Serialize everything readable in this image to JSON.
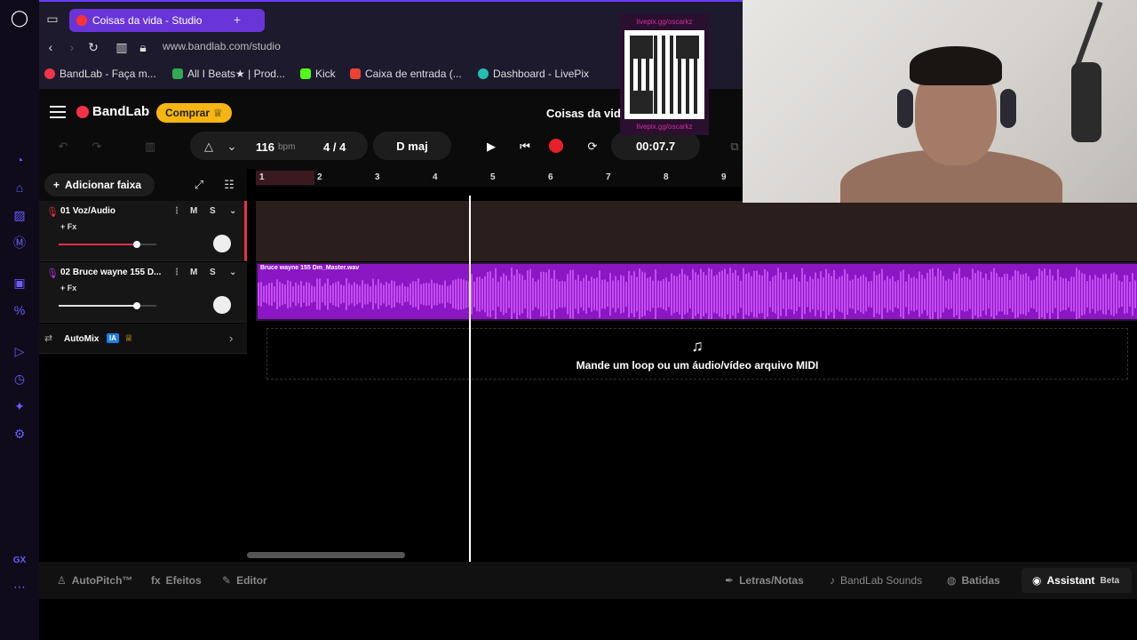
{
  "browser": {
    "tab_title": "Coisas da vida - Studio",
    "new_tab": "+",
    "url": "www.bandlab.com/studio",
    "bookmarks": [
      {
        "label": "BandLab - Faça m...",
        "color": "#f2334a"
      },
      {
        "label": "All I Beats★ | Prod...",
        "color": "#34a853"
      },
      {
        "label": "Kick",
        "color": "#53fc18"
      },
      {
        "label": "Caixa de entrada (...",
        "color": "#ea4335"
      },
      {
        "label": "Dashboard - LivePix",
        "color": "#20c0b0"
      }
    ]
  },
  "header": {
    "brand": "BandLab",
    "buy_label": "Comprar",
    "project_title": "Coisas da vid"
  },
  "transport": {
    "bpm_value": "116",
    "bpm_unit": "bpm",
    "time_sig": "4 / 4",
    "key": "D maj",
    "time": "00:07.7"
  },
  "tracks_panel": {
    "add_track_label": "Adicionar faixa",
    "tracks": [
      {
        "name": "01  Voz/Áudio",
        "fx": "+ Fx",
        "mute": "M",
        "solo": "S",
        "volume": 0.8,
        "color": "#e8304a"
      },
      {
        "name": "02  Bruce wayne 155 D...",
        "fx": "+ Fx",
        "mute": "M",
        "solo": "S",
        "volume": 0.8,
        "color": "#b02ee0"
      }
    ],
    "automix_label": "AutoMix",
    "automix_badge": "IA"
  },
  "ruler": [
    "1",
    "2",
    "3",
    "4",
    "5",
    "6",
    "7",
    "8",
    "9"
  ],
  "clip": {
    "label": "Bruce wayne 155 Dm_Master.wav"
  },
  "dropzone": {
    "text": "Mande um loop ou um áudio/vídeo arquivo MIDI"
  },
  "bottom_bar": {
    "autopitch": "AutoPitch™",
    "efeitos": "Efeitos",
    "editor": "Editor",
    "letras": "Letras/Notas",
    "sounds": "BandLab Sounds",
    "batidas": "Batidas",
    "assistant": "Assistant",
    "beta": "Beta"
  },
  "overlay": {
    "qr_top": "livepix.gg/oscarkz",
    "qr_bottom": "livepix.gg/oscarkz"
  },
  "sidebar_bottom": "GX"
}
